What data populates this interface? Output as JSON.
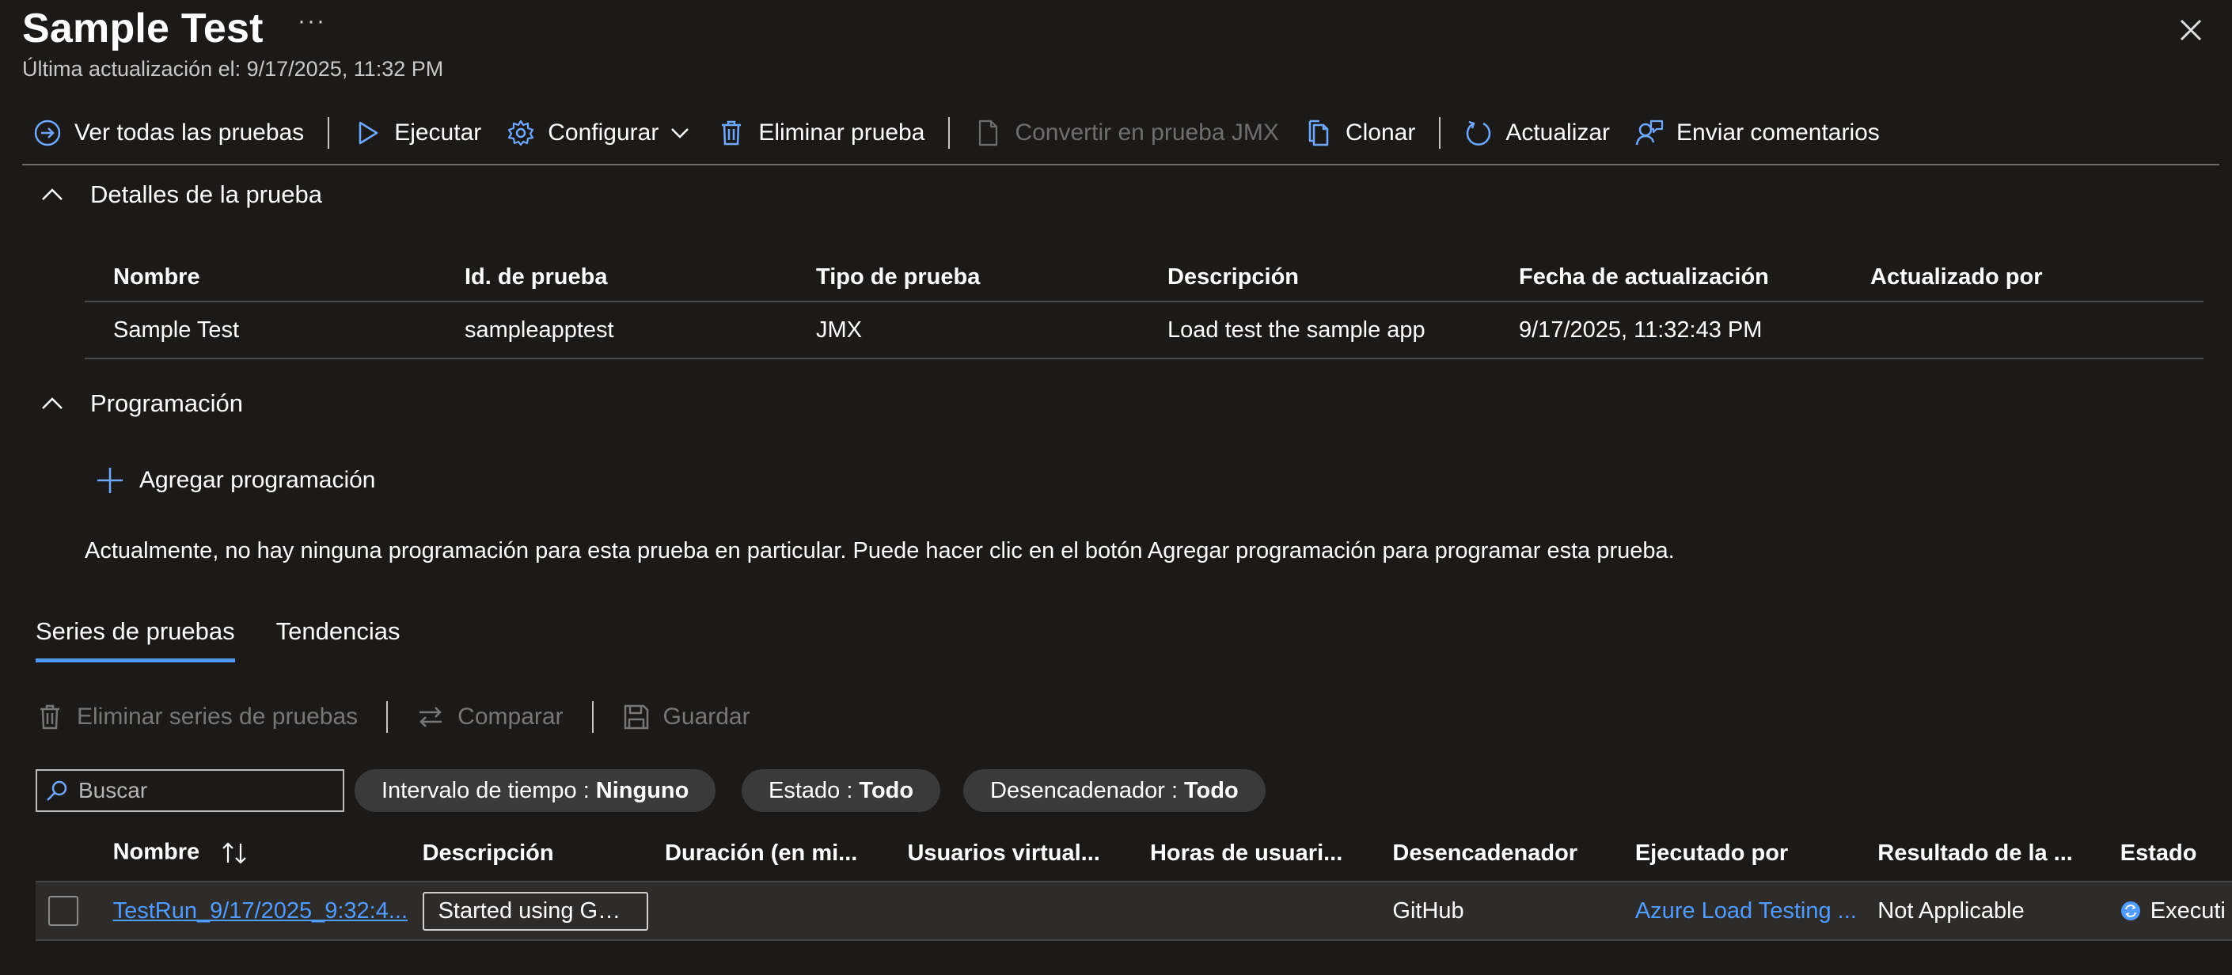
{
  "header": {
    "title": "Sample Test",
    "more": "···",
    "last_updated": "Última actualización el: 9/17/2025, 11:32 PM"
  },
  "toolbar": {
    "view_all": "Ver todas las pruebas",
    "run": "Ejecutar",
    "configure": "Configurar",
    "delete": "Eliminar prueba",
    "convert": "Convertir en prueba JMX",
    "clone": "Clonar",
    "refresh": "Actualizar",
    "feedback": "Enviar comentarios"
  },
  "details": {
    "section_title": "Detalles de la prueba",
    "columns": [
      "Nombre",
      "Id. de prueba",
      "Tipo de prueba",
      "Descripción",
      "Fecha de actualización",
      "Actualizado por"
    ],
    "row": [
      "Sample Test",
      "sampleapptest",
      "JMX",
      "Load test the sample app",
      "9/17/2025, 11:32:43 PM",
      ""
    ]
  },
  "schedule": {
    "section_title": "Programación",
    "add_label": "Agregar programación",
    "empty_text": "Actualmente, no hay ninguna programación para esta prueba en particular. Puede hacer clic en el botón Agregar programación para programar esta prueba."
  },
  "tabs": [
    {
      "label": "Series de pruebas",
      "active": true
    },
    {
      "label": "Tendencias",
      "active": false
    }
  ],
  "runs_toolbar": {
    "delete_runs": "Eliminar series de pruebas",
    "compare": "Comparar",
    "save": "Guardar"
  },
  "filters": {
    "search_placeholder": "Buscar",
    "time_range_label": "Intervalo de tiempo : ",
    "time_range_value": "Ninguno",
    "status_label": "Estado : ",
    "status_value": "Todo",
    "trigger_label": "Desencadenador : ",
    "trigger_value": "Todo"
  },
  "grid": {
    "columns": [
      "Nombre",
      "Descripción",
      "Duración (en mi...",
      "Usuarios virtual...",
      "Horas de usuari...",
      "Desencadenador",
      "Ejecutado por",
      "Resultado de la ...",
      "Estado"
    ],
    "rows": [
      {
        "name": "TestRun_9/17/2025_9:32:4...",
        "description": "Started using GH ...",
        "duration": "",
        "virtual_users": "",
        "user_hours": "",
        "trigger": "GitHub",
        "executed_by": "Azure Load Testing ...",
        "result": "Not Applicable",
        "status": "Executi"
      }
    ]
  },
  "colors": {
    "background": "#1b1a19",
    "accent": "#4f9bff",
    "pill": "#3a3a3a",
    "row": "#2d2c2b"
  }
}
